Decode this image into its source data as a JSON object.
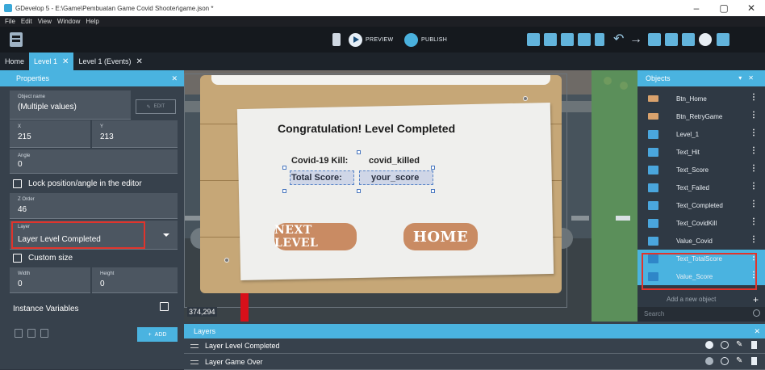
{
  "window": {
    "title": "GDevelop 5 - E:\\Game\\Pembuatan Game Covid Shooter\\game.json *",
    "controls": [
      "–",
      "▢",
      "✕"
    ]
  },
  "menu": [
    "File",
    "Edit",
    "View",
    "Window",
    "Help"
  ],
  "toolbar": {
    "preview_label": "PREVIEW",
    "publish_label": "PUBLISH",
    "icons": [
      "scene-objects-icon",
      "object-groups-icon",
      "properties-icon",
      "layers-icon",
      "instances-list-icon",
      "undo-icon",
      "redo-icon",
      "edit-instance-icon",
      "grid-icon",
      "zoom-icon",
      "window-icon"
    ]
  },
  "tabs": [
    {
      "label": "Home",
      "active": false,
      "closable": false
    },
    {
      "label": "Level 1",
      "active": true,
      "closable": true
    },
    {
      "label": "Level 1 (Events)",
      "active": false,
      "closable": true
    }
  ],
  "properties": {
    "title": "Properties",
    "object_name_label": "Object name",
    "object_name_value": "(Multiple values)",
    "edit_label": "EDIT",
    "x_label": "X",
    "x_value": "215",
    "y_label": "Y",
    "y_value": "213",
    "angle_label": "Angle",
    "angle_value": "0",
    "lock_label": "Lock position/angle in the editor",
    "zorder_label": "Z Order",
    "zorder_value": "46",
    "layer_label": "Layer",
    "layer_value": "Layer Level Completed",
    "custom_size_label": "Custom size",
    "width_label": "Width",
    "width_value": "0",
    "height_label": "Height",
    "height_value": "0",
    "instance_vars_label": "Instance Variables",
    "add_label": "ADD"
  },
  "scene": {
    "coord_readout": "374,294",
    "congrats_text": "Congratulation! Level Completed",
    "kill_label": "Covid-19 Kill:",
    "kill_value": "covid_killed",
    "score_label": "Total Score:",
    "score_value": "your_score",
    "next_level_label": "NEXT LEVEL",
    "home_label": "HOME"
  },
  "objects": {
    "title": "Objects",
    "items": [
      {
        "name": "Btn_Home",
        "kind": "button",
        "selected": false
      },
      {
        "name": "Btn_RetryGame",
        "kind": "button",
        "selected": false
      },
      {
        "name": "Level_1",
        "kind": "text",
        "selected": false
      },
      {
        "name": "Text_Hit",
        "kind": "text",
        "selected": false
      },
      {
        "name": "Text_Score",
        "kind": "text",
        "selected": false
      },
      {
        "name": "Text_Failed",
        "kind": "text",
        "selected": false
      },
      {
        "name": "Text_Completed",
        "kind": "text",
        "selected": false
      },
      {
        "name": "Text_CovidKill",
        "kind": "text",
        "selected": false
      },
      {
        "name": "Value_Covid",
        "kind": "text",
        "selected": false
      },
      {
        "name": "Text_TotalScore",
        "kind": "text",
        "selected": true
      },
      {
        "name": "Value_Score",
        "kind": "text",
        "selected": true
      }
    ],
    "add_label": "Add a new object",
    "search_placeholder": "Search"
  },
  "layers": {
    "title": "Layers",
    "items": [
      {
        "name": "Layer Level Completed"
      },
      {
        "name": "Layer Game Over"
      }
    ]
  },
  "colors": {
    "accent": "#4ab3e0",
    "highlight": "#e0342c",
    "panel": "#37414c",
    "toolbar": "#15191e"
  }
}
